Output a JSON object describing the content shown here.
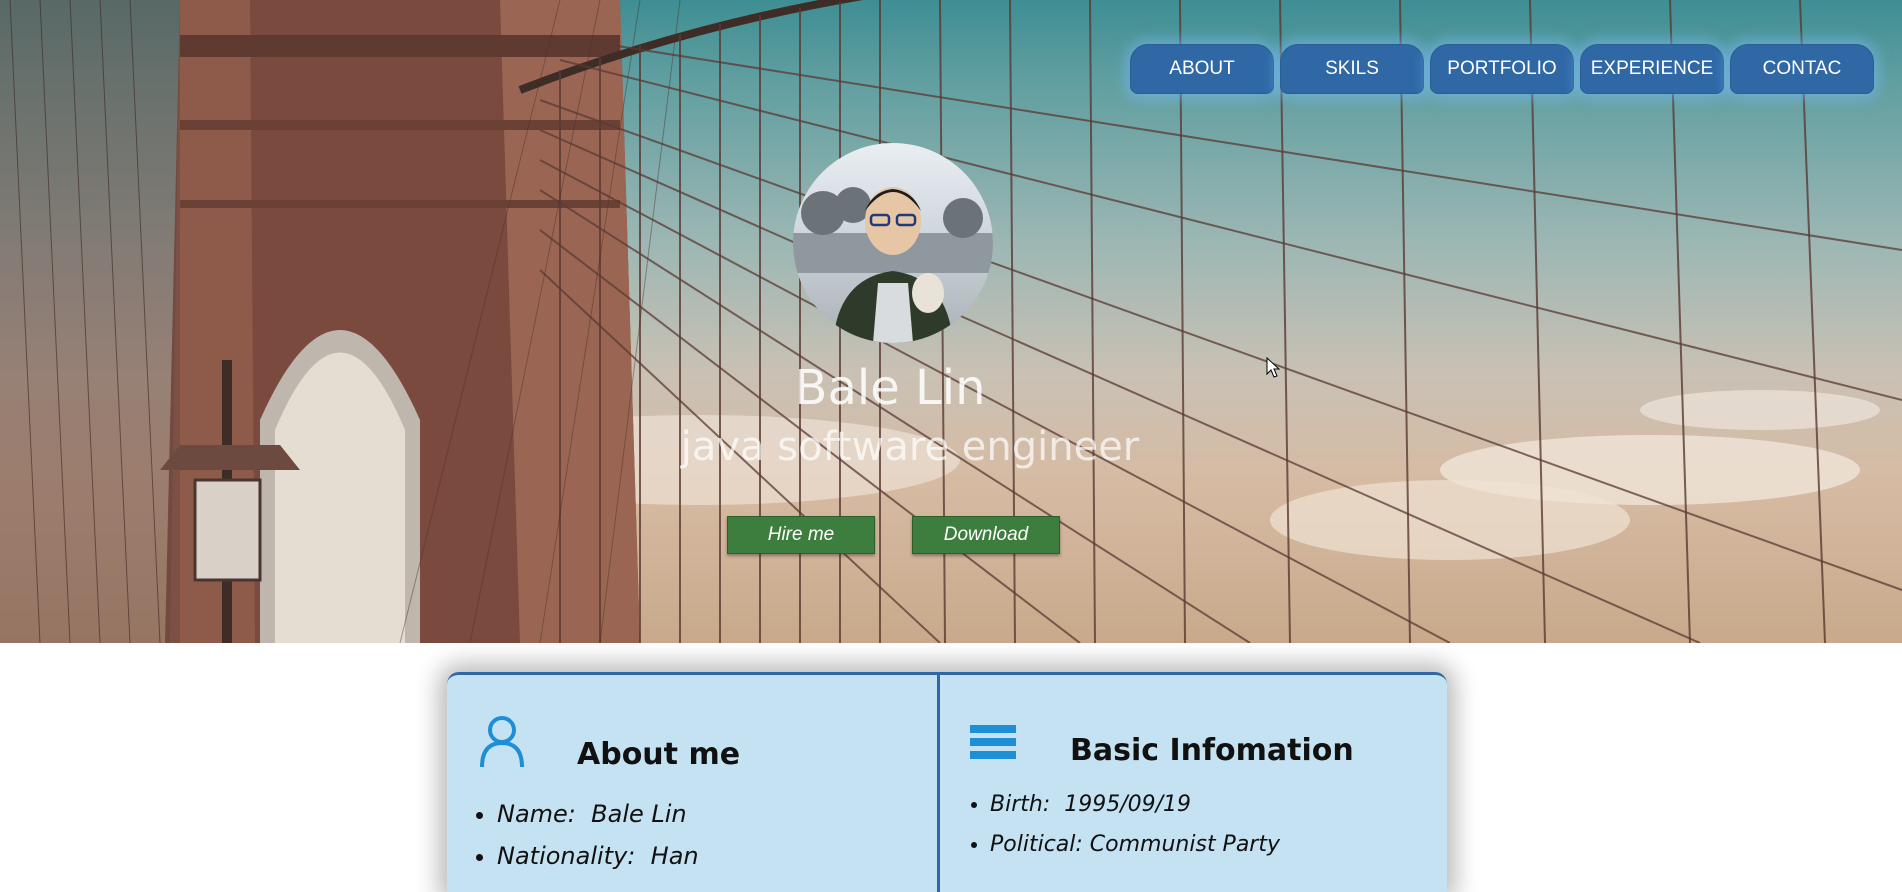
{
  "nav": {
    "items": [
      {
        "label": "ABOUT"
      },
      {
        "label": "SKILS"
      },
      {
        "label": "PORTFOLIO"
      },
      {
        "label": "EXPERIENCE"
      },
      {
        "label": "CONTAC"
      }
    ]
  },
  "profile": {
    "name": "Bale Lin",
    "title": "java software engineer"
  },
  "actions": {
    "hire_label": "Hire me",
    "download_label": "Download"
  },
  "about": {
    "heading": "About me",
    "icon": "user-icon",
    "items": [
      {
        "label": "Name:",
        "value": "Bale Lin"
      },
      {
        "label": "Nationality:",
        "value": "Han"
      }
    ]
  },
  "basic": {
    "heading": "Basic Infomation",
    "icon": "list-icon",
    "items": [
      {
        "label": "Birth:",
        "value": "1995/09/19"
      },
      {
        "label": "Political:",
        "value": "Communist Party"
      }
    ]
  },
  "colors": {
    "nav_button": "#2f68a5",
    "cta_button": "#3d7d3e",
    "card_background": "#c5e2f2",
    "accent_icon": "#1e8fd6"
  }
}
